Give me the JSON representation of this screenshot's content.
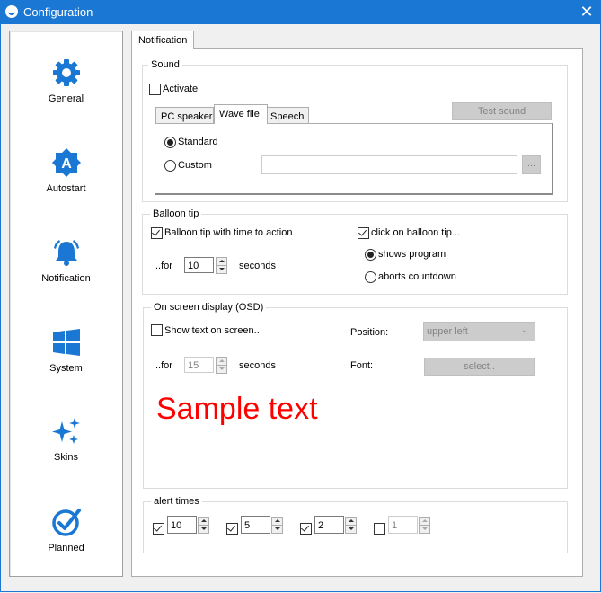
{
  "window": {
    "title": "Configuration",
    "close_glyph": "✕"
  },
  "sidebar": {
    "items": [
      {
        "label": "General",
        "icon": "gear-icon"
      },
      {
        "label": "Autostart",
        "icon": "autostart-badge-icon"
      },
      {
        "label": "Notification",
        "icon": "bell-icon"
      },
      {
        "label": "System",
        "icon": "windows-logo-icon"
      },
      {
        "label": "Skins",
        "icon": "sparkles-icon"
      },
      {
        "label": "Planned",
        "icon": "check-circle-icon"
      }
    ]
  },
  "tab": {
    "label": "Notification"
  },
  "sound": {
    "group_label": "Sound",
    "activate_label": "Activate",
    "test_button": "Test sound",
    "subtabs": [
      "PC speaker",
      "Wave file",
      "Speech"
    ],
    "standard_label": "Standard",
    "custom_label": "Custom",
    "custom_path": "",
    "browse_label": "..."
  },
  "balloon": {
    "group_label": "Balloon tip",
    "with_time_label": "Balloon tip with time to action",
    "for_label": "..for",
    "seconds_value": "10",
    "seconds_label": "seconds",
    "click_label": "click on balloon tip...",
    "shows_program_label": "shows program",
    "aborts_label": "aborts countdown"
  },
  "osd": {
    "group_label": "On screen display (OSD)",
    "show_text_label": "Show text on screen..",
    "for_label": "..for",
    "seconds_value": "15",
    "seconds_label": "seconds",
    "position_label": "Position:",
    "position_value": "upper left",
    "font_label": "Font:",
    "font_button": "select..",
    "sample_text": "Sample text"
  },
  "alert_times": {
    "group_label": "alert times",
    "values": [
      "10",
      "5",
      "2",
      "1"
    ]
  },
  "colors": {
    "accent": "#1a78d4",
    "sample_text": "#ff0000"
  }
}
